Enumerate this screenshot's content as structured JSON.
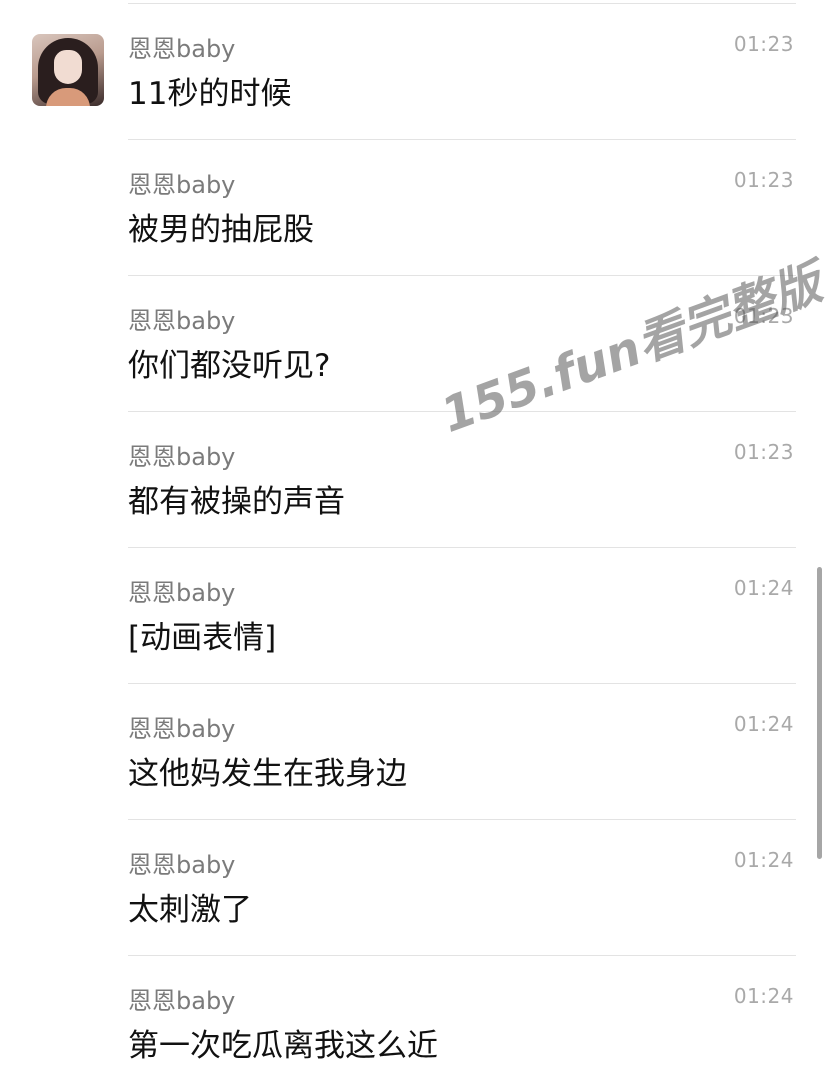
{
  "contact": {
    "avatar_icon": "avatar"
  },
  "messages": [
    {
      "sender": "恩恩baby",
      "time": "01:23",
      "text": "11秒的时候"
    },
    {
      "sender": "恩恩baby",
      "time": "01:23",
      "text": "被男的抽屁股"
    },
    {
      "sender": "恩恩baby",
      "time": "01:23",
      "text": "你们都没听见?"
    },
    {
      "sender": "恩恩baby",
      "time": "01:23",
      "text": "都有被操的声音"
    },
    {
      "sender": "恩恩baby",
      "time": "01:24",
      "text": "[动画表情]"
    },
    {
      "sender": "恩恩baby",
      "time": "01:24",
      "text": "这他妈发生在我身边"
    },
    {
      "sender": "恩恩baby",
      "time": "01:24",
      "text": "太刺激了"
    },
    {
      "sender": "恩恩baby",
      "time": "01:24",
      "text": "第一次吃瓜离我这么近"
    }
  ],
  "watermark": {
    "text": "155.fun看完整版"
  },
  "colors": {
    "divider": "#e3e3e3",
    "sender": "#7b7b7b",
    "time": "#a9a9a9",
    "text": "#111111"
  }
}
